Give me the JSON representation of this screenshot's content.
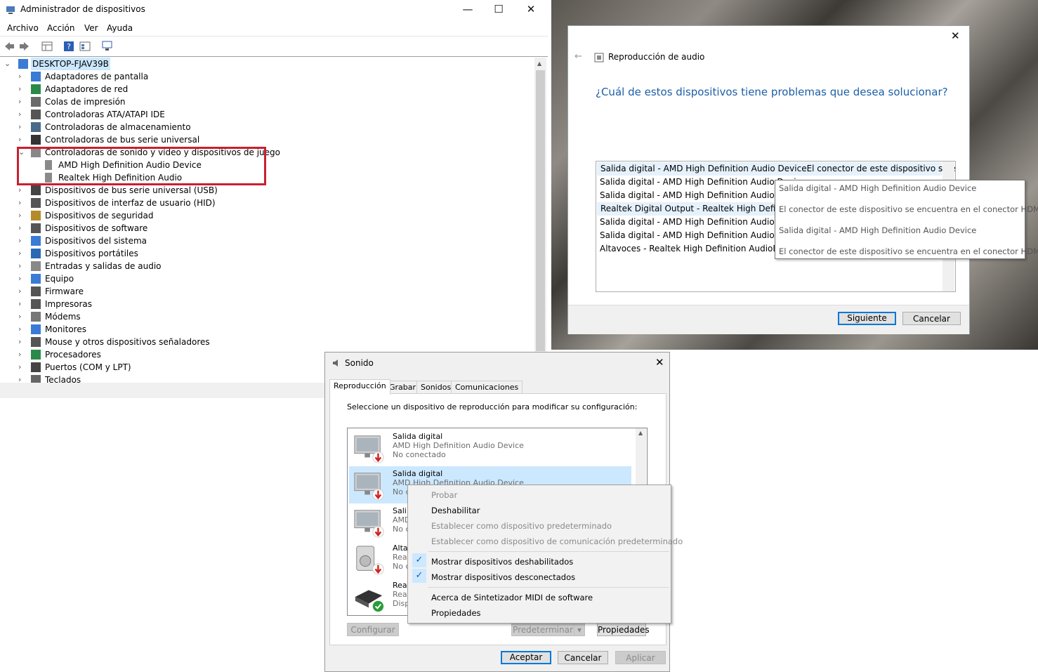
{
  "device_manager": {
    "title": "Administrador de dispositivos",
    "menu": [
      "Archivo",
      "Acción",
      "Ver",
      "Ayuda"
    ],
    "root": "DESKTOP-FJAV39B",
    "categories": [
      {
        "label": "Adaptadores de pantalla",
        "icon": "display-adapter-icon"
      },
      {
        "label": "Adaptadores de red",
        "icon": "network-adapter-icon"
      },
      {
        "label": "Colas de impresión",
        "icon": "print-queue-icon"
      },
      {
        "label": "Controladoras ATA/ATAPI IDE",
        "icon": "ide-controller-icon"
      },
      {
        "label": "Controladoras de almacenamiento",
        "icon": "storage-controller-icon"
      },
      {
        "label": "Controladoras de bus serie universal",
        "icon": "usb-controller-icon"
      },
      {
        "label": "Controladoras de sonido y vídeo y dispositivos de juego",
        "icon": "sound-icon",
        "expanded": true,
        "children": [
          "AMD High Definition Audio Device",
          "Realtek High Definition Audio"
        ]
      },
      {
        "label": "Dispositivos de bus serie universal (USB)",
        "icon": "usb-device-icon"
      },
      {
        "label": "Dispositivos de interfaz de usuario (HID)",
        "icon": "hid-icon"
      },
      {
        "label": "Dispositivos de seguridad",
        "icon": "security-icon"
      },
      {
        "label": "Dispositivos de software",
        "icon": "software-device-icon"
      },
      {
        "label": "Dispositivos del sistema",
        "icon": "system-device-icon"
      },
      {
        "label": "Dispositivos portátiles",
        "icon": "portable-device-icon"
      },
      {
        "label": "Entradas y salidas de audio",
        "icon": "audio-io-icon"
      },
      {
        "label": "Equipo",
        "icon": "computer-icon"
      },
      {
        "label": "Firmware",
        "icon": "firmware-icon"
      },
      {
        "label": "Impresoras",
        "icon": "printer-icon"
      },
      {
        "label": "Módems",
        "icon": "modem-icon"
      },
      {
        "label": "Monitores",
        "icon": "monitor-icon"
      },
      {
        "label": "Mouse y otros dispositivos señaladores",
        "icon": "mouse-icon"
      },
      {
        "label": "Procesadores",
        "icon": "processor-icon"
      },
      {
        "label": "Puertos (COM y LPT)",
        "icon": "ports-icon"
      },
      {
        "label": "Teclados",
        "icon": "keyboard-icon"
      }
    ],
    "highlight_color": "#c8202f"
  },
  "troubleshooter": {
    "title": "Reproducción de audio",
    "question": "¿Cuál de estos dispositivos tiene problemas que desea solucionar?",
    "items": [
      "Salida digital - AMD High Definition Audio DeviceEl conector de este dispositivo se encue...",
      "Salida digital - AMD High Definition Audio Devic",
      "Salida digital - AMD High Definition Audio Devic",
      "Realtek Digital Output - Realtek High Definition",
      "Salida digital - AMD High Definition Audio Devic",
      "Salida digital - AMD High Definition Audio Devic",
      "Altavoces - Realtek High Definition AudioEl cor"
    ],
    "selected_index": 3,
    "tooltip": [
      "Salida digital - AMD High Definition Audio Device",
      "El conector de este dispositivo se encuentra en el conector HDMI.",
      "Salida digital - AMD High Definition Audio Device",
      "El conector de este dispositivo se encuentra en el conector HDMI."
    ],
    "next_label": "Siguiente",
    "cancel_label": "Cancelar",
    "accent": "#1c5ea8"
  },
  "sound": {
    "title": "Sonido",
    "tabs": [
      "Reproducción",
      "Grabar",
      "Sonidos",
      "Comunicaciones"
    ],
    "instruction": "Seleccione un dispositivo de reproducción para modificar su configuración:",
    "devices": [
      {
        "name": "Salida digital",
        "driver": "AMD High Definition Audio Device",
        "status": "No conectado",
        "badge": "down-arrow-red-icon"
      },
      {
        "name": "Salida digital",
        "driver": "AMD High Definition Audio Device",
        "status": "No c",
        "badge": "down-arrow-red-icon"
      },
      {
        "name": "Sali",
        "driver": "AMD",
        "status": "No c",
        "badge": "down-arrow-red-icon"
      },
      {
        "name": "Alta",
        "driver": "Rea",
        "status": "No c",
        "badge": "down-arrow-red-icon"
      },
      {
        "name": "Rea",
        "driver": "Rea",
        "status": "Disp",
        "badge": "green-check-icon"
      }
    ],
    "context_menu": {
      "items": [
        {
          "label": "Probar",
          "disabled": true
        },
        {
          "label": "Deshabilitar",
          "disabled": false
        },
        {
          "label": "Establecer como dispositivo predeterminado",
          "disabled": true
        },
        {
          "label": "Establecer como dispositivo de comunicación predeterminado",
          "disabled": true
        },
        {
          "label": "Mostrar dispositivos deshabilitados",
          "checked": true
        },
        {
          "label": "Mostrar dispositivos desconectados",
          "checked": true
        },
        {
          "label": "Acerca de Sintetizador MIDI de software"
        },
        {
          "label": "Propiedades"
        }
      ]
    },
    "configure_label": "Configurar",
    "default_label": "Predeterminar",
    "properties_label": "Propiedades",
    "ok_label": "Aceptar",
    "cancel_label": "Cancelar",
    "apply_label": "Aplicar"
  }
}
